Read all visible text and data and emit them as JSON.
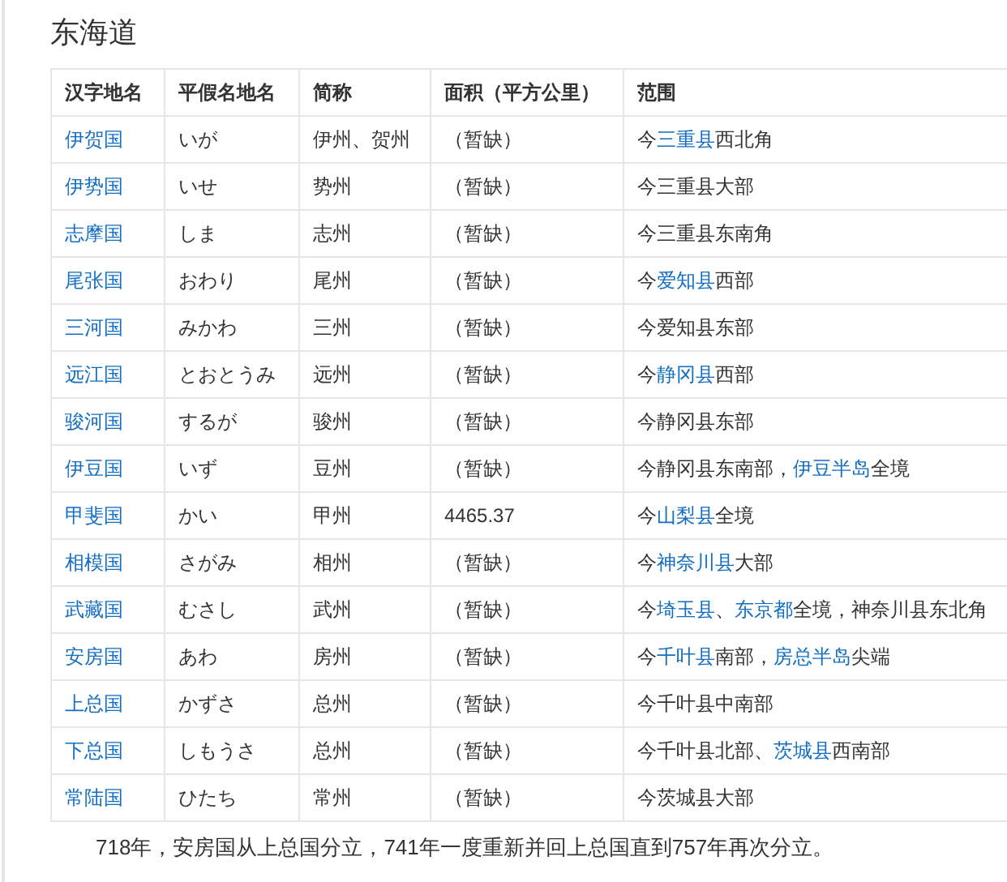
{
  "title": "东海道",
  "table": {
    "columns": [
      "汉字地名",
      "平假名地名",
      "简称",
      "面积（平方公里）",
      "范围"
    ],
    "rows": [
      {
        "name": "伊贺国",
        "kana": "いが",
        "abbr": "伊州、贺州",
        "area": "（暂缺）",
        "range": [
          {
            "text": "今",
            "link": false
          },
          {
            "text": "三重县",
            "link": true
          },
          {
            "text": "西北角",
            "link": false
          }
        ]
      },
      {
        "name": "伊势国",
        "kana": "いせ",
        "abbr": "势州",
        "area": "（暂缺）",
        "range": [
          {
            "text": "今三重县大部",
            "link": false
          }
        ]
      },
      {
        "name": "志摩国",
        "kana": "しま",
        "abbr": "志州",
        "area": "（暂缺）",
        "range": [
          {
            "text": "今三重县东南角",
            "link": false
          }
        ]
      },
      {
        "name": "尾张国",
        "kana": "おわり",
        "abbr": "尾州",
        "area": "（暂缺）",
        "range": [
          {
            "text": "今",
            "link": false
          },
          {
            "text": "爱知县",
            "link": true
          },
          {
            "text": "西部",
            "link": false
          }
        ]
      },
      {
        "name": "三河国",
        "kana": "みかわ",
        "abbr": "三州",
        "area": "（暂缺）",
        "range": [
          {
            "text": "今爱知县东部",
            "link": false
          }
        ]
      },
      {
        "name": "远江国",
        "kana": "とおとうみ",
        "abbr": "远州",
        "area": "（暂缺）",
        "range": [
          {
            "text": "今",
            "link": false
          },
          {
            "text": "静冈县",
            "link": true
          },
          {
            "text": "西部",
            "link": false
          }
        ]
      },
      {
        "name": "骏河国",
        "kana": "するが",
        "abbr": "骏州",
        "area": "（暂缺）",
        "range": [
          {
            "text": "今静冈县东部",
            "link": false
          }
        ]
      },
      {
        "name": "伊豆国",
        "kana": "いず",
        "abbr": "豆州",
        "area": "（暂缺）",
        "range": [
          {
            "text": "今静冈县东南部，",
            "link": false
          },
          {
            "text": "伊豆半岛",
            "link": true
          },
          {
            "text": "全境",
            "link": false
          }
        ]
      },
      {
        "name": "甲斐国",
        "kana": "かい",
        "abbr": "甲州",
        "area": "4465.37",
        "range": [
          {
            "text": "今",
            "link": false
          },
          {
            "text": "山梨县",
            "link": true
          },
          {
            "text": "全境",
            "link": false
          }
        ]
      },
      {
        "name": "相模国",
        "kana": "さがみ",
        "abbr": "相州",
        "area": "（暂缺）",
        "range": [
          {
            "text": "今",
            "link": false
          },
          {
            "text": "神奈川县",
            "link": true
          },
          {
            "text": "大部",
            "link": false
          }
        ]
      },
      {
        "name": "武藏国",
        "kana": "むさし",
        "abbr": "武州",
        "area": "（暂缺）",
        "range": [
          {
            "text": "今",
            "link": false
          },
          {
            "text": "埼玉县",
            "link": true
          },
          {
            "text": "、",
            "link": false
          },
          {
            "text": "东京都",
            "link": true
          },
          {
            "text": "全境，神奈川县东北角",
            "link": false
          }
        ]
      },
      {
        "name": "安房国",
        "kana": "あわ",
        "abbr": "房州",
        "area": "（暂缺）",
        "range": [
          {
            "text": "今",
            "link": false
          },
          {
            "text": "千叶县",
            "link": true
          },
          {
            "text": "南部，",
            "link": false
          },
          {
            "text": "房总半岛",
            "link": true
          },
          {
            "text": "尖端",
            "link": false
          }
        ]
      },
      {
        "name": "上总国",
        "kana": "かずさ",
        "abbr": "总州",
        "area": "（暂缺）",
        "range": [
          {
            "text": "今千叶县中南部",
            "link": false
          }
        ]
      },
      {
        "name": "下总国",
        "kana": "しもうさ",
        "abbr": "总州",
        "area": "（暂缺）",
        "range": [
          {
            "text": "今千叶县北部、",
            "link": false
          },
          {
            "text": "茨城县",
            "link": true
          },
          {
            "text": "西南部",
            "link": false
          }
        ]
      },
      {
        "name": "常陆国",
        "kana": "ひたち",
        "abbr": "常州",
        "area": "（暂缺）",
        "range": [
          {
            "text": "今茨城县大部",
            "link": false
          }
        ]
      }
    ]
  },
  "note": "718年，安房国从上总国分立，741年一度重新并回上总国直到757年再次分立。"
}
